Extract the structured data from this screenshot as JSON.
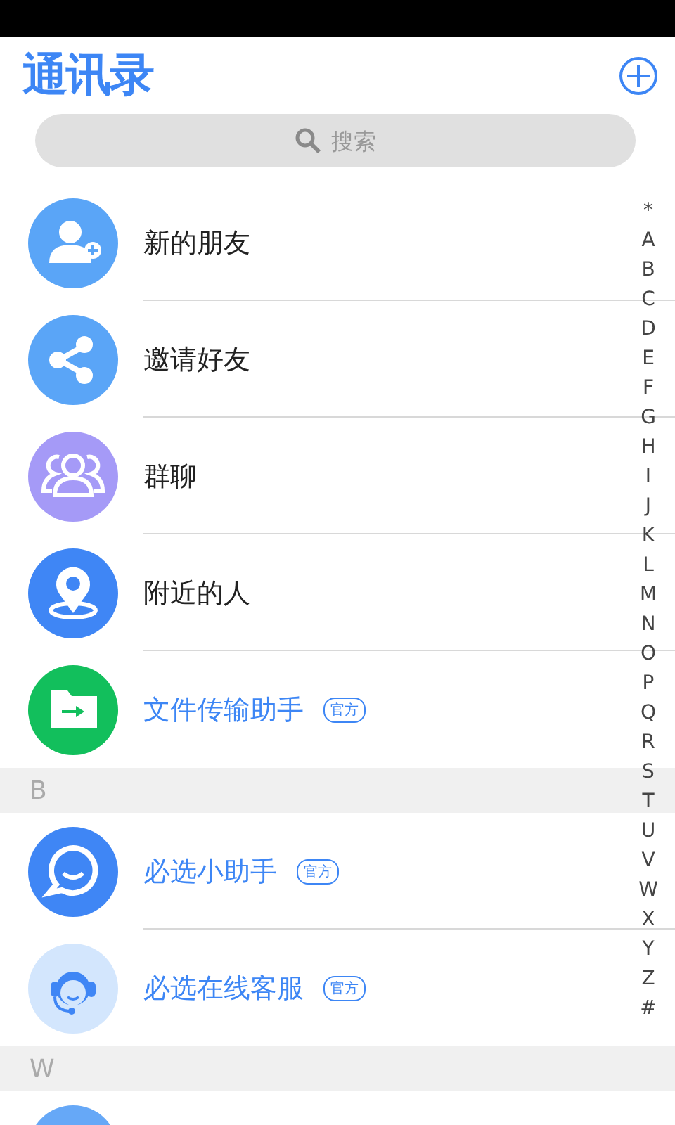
{
  "header": {
    "title": "通讯录"
  },
  "search": {
    "placeholder": "搜索"
  },
  "sections": [
    {
      "items": [
        {
          "kind": "new-friend",
          "name": "新的朋友",
          "official": false
        },
        {
          "kind": "share",
          "name": "邀请好友",
          "official": false
        },
        {
          "kind": "group",
          "name": "群聊",
          "official": false
        },
        {
          "kind": "location",
          "name": "附近的人",
          "official": false
        },
        {
          "kind": "file-transfer",
          "name": "文件传输助手",
          "official": true,
          "badge": "官方"
        }
      ]
    },
    {
      "header": "B",
      "items": [
        {
          "kind": "chat",
          "name": "必选小助手",
          "official": true,
          "badge": "官方"
        },
        {
          "kind": "service",
          "name": "必选在线客服",
          "official": true,
          "badge": "官方"
        }
      ]
    },
    {
      "header": "W",
      "items": [
        {
          "kind": "avatar"
        }
      ]
    }
  ],
  "index": [
    "*",
    "A",
    "B",
    "C",
    "D",
    "E",
    "F",
    "G",
    "H",
    "I",
    "J",
    "K",
    "L",
    "M",
    "N",
    "O",
    "P",
    "Q",
    "R",
    "S",
    "T",
    "U",
    "V",
    "W",
    "X",
    "Y",
    "Z",
    "#"
  ]
}
